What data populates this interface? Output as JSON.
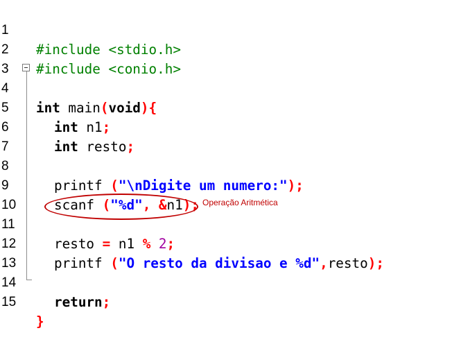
{
  "editor": {
    "line_numbers": [
      "1",
      "2",
      "3",
      "4",
      "5",
      "6",
      "7",
      "8",
      "9",
      "10",
      "11",
      "12",
      "13",
      "14",
      "15"
    ],
    "lines": {
      "l1": {
        "a": "#include <stdio.h>"
      },
      "l2": {
        "a": "#include <conio.h>"
      },
      "l4": {
        "kw1": "int",
        "t1": " main",
        "op1": "(",
        "kw2": "void",
        "op2": "){"
      },
      "l5": {
        "kw": "int",
        "t": " n1",
        "op": ";"
      },
      "l6": {
        "kw": "int",
        "t": " resto",
        "op": ";"
      },
      "l8": {
        "t": "printf ",
        "op1": "(",
        "str": "\"\\nDigite um numero:\"",
        "op2": ");"
      },
      "l9": {
        "t": "scanf ",
        "op1": "(",
        "str": "\"%d\"",
        "op2": ", &",
        "t2": "n1",
        "op3": ");"
      },
      "l11": {
        "t": "resto ",
        "op1": "=",
        "t2": " n1 ",
        "op2": "%",
        "sp": " ",
        "num": "2",
        "op3": ";"
      },
      "l12": {
        "t": "printf ",
        "op1": "(",
        "str": "\"O resto da divisao e %d\"",
        "op2": ",",
        "t2": "resto",
        "op3": ");"
      },
      "l14": {
        "kw": "return",
        "op": ";"
      },
      "l15": {
        "op": "}"
      }
    }
  },
  "annotation": {
    "text": "Operação Aritmética"
  },
  "colors": {
    "preprocessor": "#008000",
    "operator": "#ff0000",
    "string": "#0000ff",
    "number": "#a000a0",
    "annotation": "#c00000"
  }
}
